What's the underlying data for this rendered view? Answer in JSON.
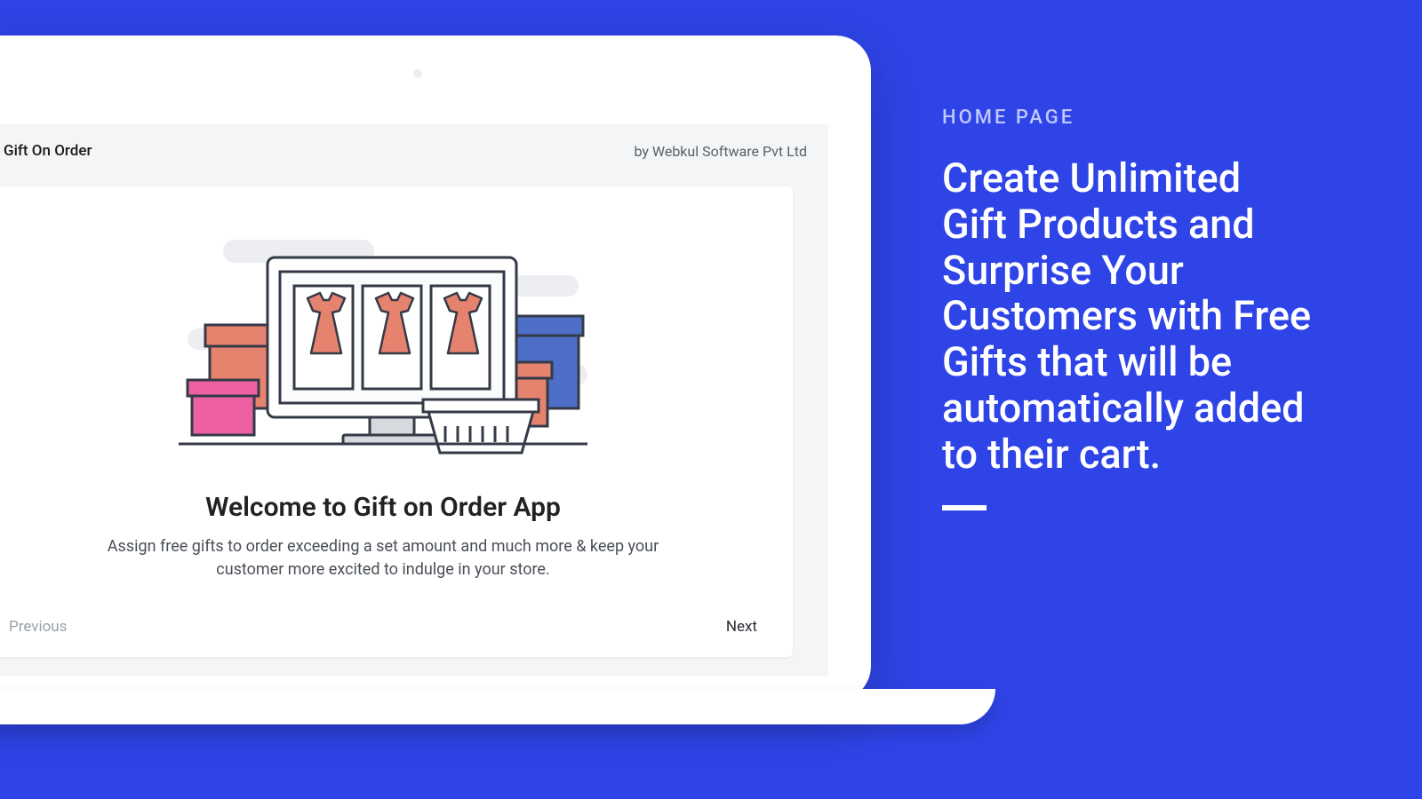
{
  "marketing": {
    "eyebrow": "HOME PAGE",
    "headline": "Create Unlimited Gift Products and Surprise Your Customers with Free Gifts that will be automatically added to their cart."
  },
  "topbar": {
    "title": "Gift On Order",
    "vendor": "by Webkul Software Pvt Ltd"
  },
  "onboarding": {
    "heading": "Welcome to Gift on Order App",
    "subheading": "Assign free gifts to order exceeding a set amount and much more & keep your customer more excited to indulge in your store.",
    "prev_label": "Previous",
    "next_label": "Next"
  },
  "colors": {
    "brand_bg": "#2e44e6",
    "dress": "#e6836f",
    "box_red": "#e6836f",
    "box_blue": "#4d6fc7",
    "box_pink": "#ed60a1",
    "outline": "#343a47"
  }
}
